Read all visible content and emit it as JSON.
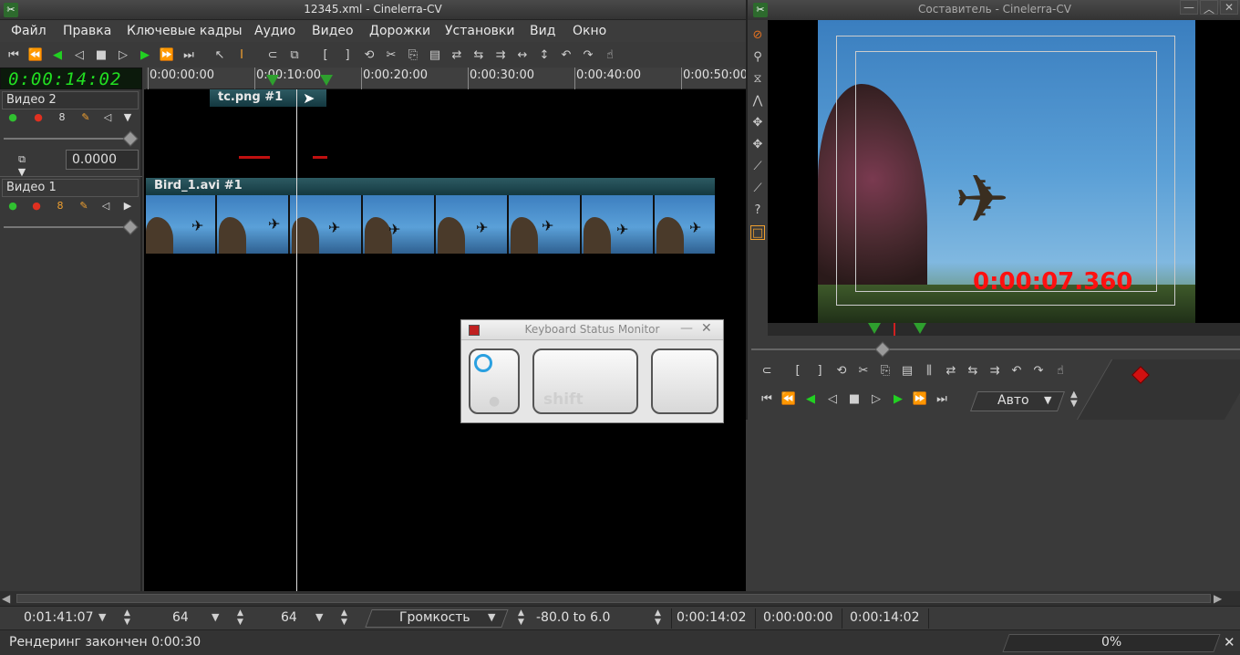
{
  "main": {
    "title": "12345.xml - Cinelerra-CV",
    "menu": [
      "Файл",
      "Правка",
      "Ключевые кадры",
      "Аудио",
      "Видео",
      "Дорожки",
      "Установки",
      "Вид",
      "Окно"
    ],
    "timecode": "0:00:14:02",
    "ruler_labels": [
      "0:00:00:00",
      "0:00:10:00",
      "0:00:20:00",
      "0:00:30:00",
      "0:00:40:00",
      "0:00:50:00"
    ]
  },
  "tracks": {
    "video2": {
      "title": "Видео 2",
      "value": "0.0000"
    },
    "video1": {
      "title": "Видео 1"
    }
  },
  "clips": {
    "clip1": "tc.png #1",
    "clip2": "Bird_1.avi #1"
  },
  "composer": {
    "title": "Составитель - Cinelerra-CV",
    "overlay_timecode": "0:00:07.360",
    "auto_label": "Авто"
  },
  "ksm": {
    "title": "Keyboard Status Monitor",
    "shift_label": "shift"
  },
  "bottom": {
    "length": "0:01:41:07",
    "zoom1": "64",
    "zoom2": "64",
    "volume_label": "Громкость",
    "range": "-80.0 to 6.0",
    "time1": "0:00:14:02",
    "time2": "0:00:00:00",
    "time3": "0:00:14:02"
  },
  "status": {
    "text": "Рендеринг закончен 0:00:30",
    "progress": "0%"
  },
  "colors": {
    "timecode_green": "#22e022",
    "overlay_red": "#ff1010",
    "clip_header": "#1f4a52"
  }
}
